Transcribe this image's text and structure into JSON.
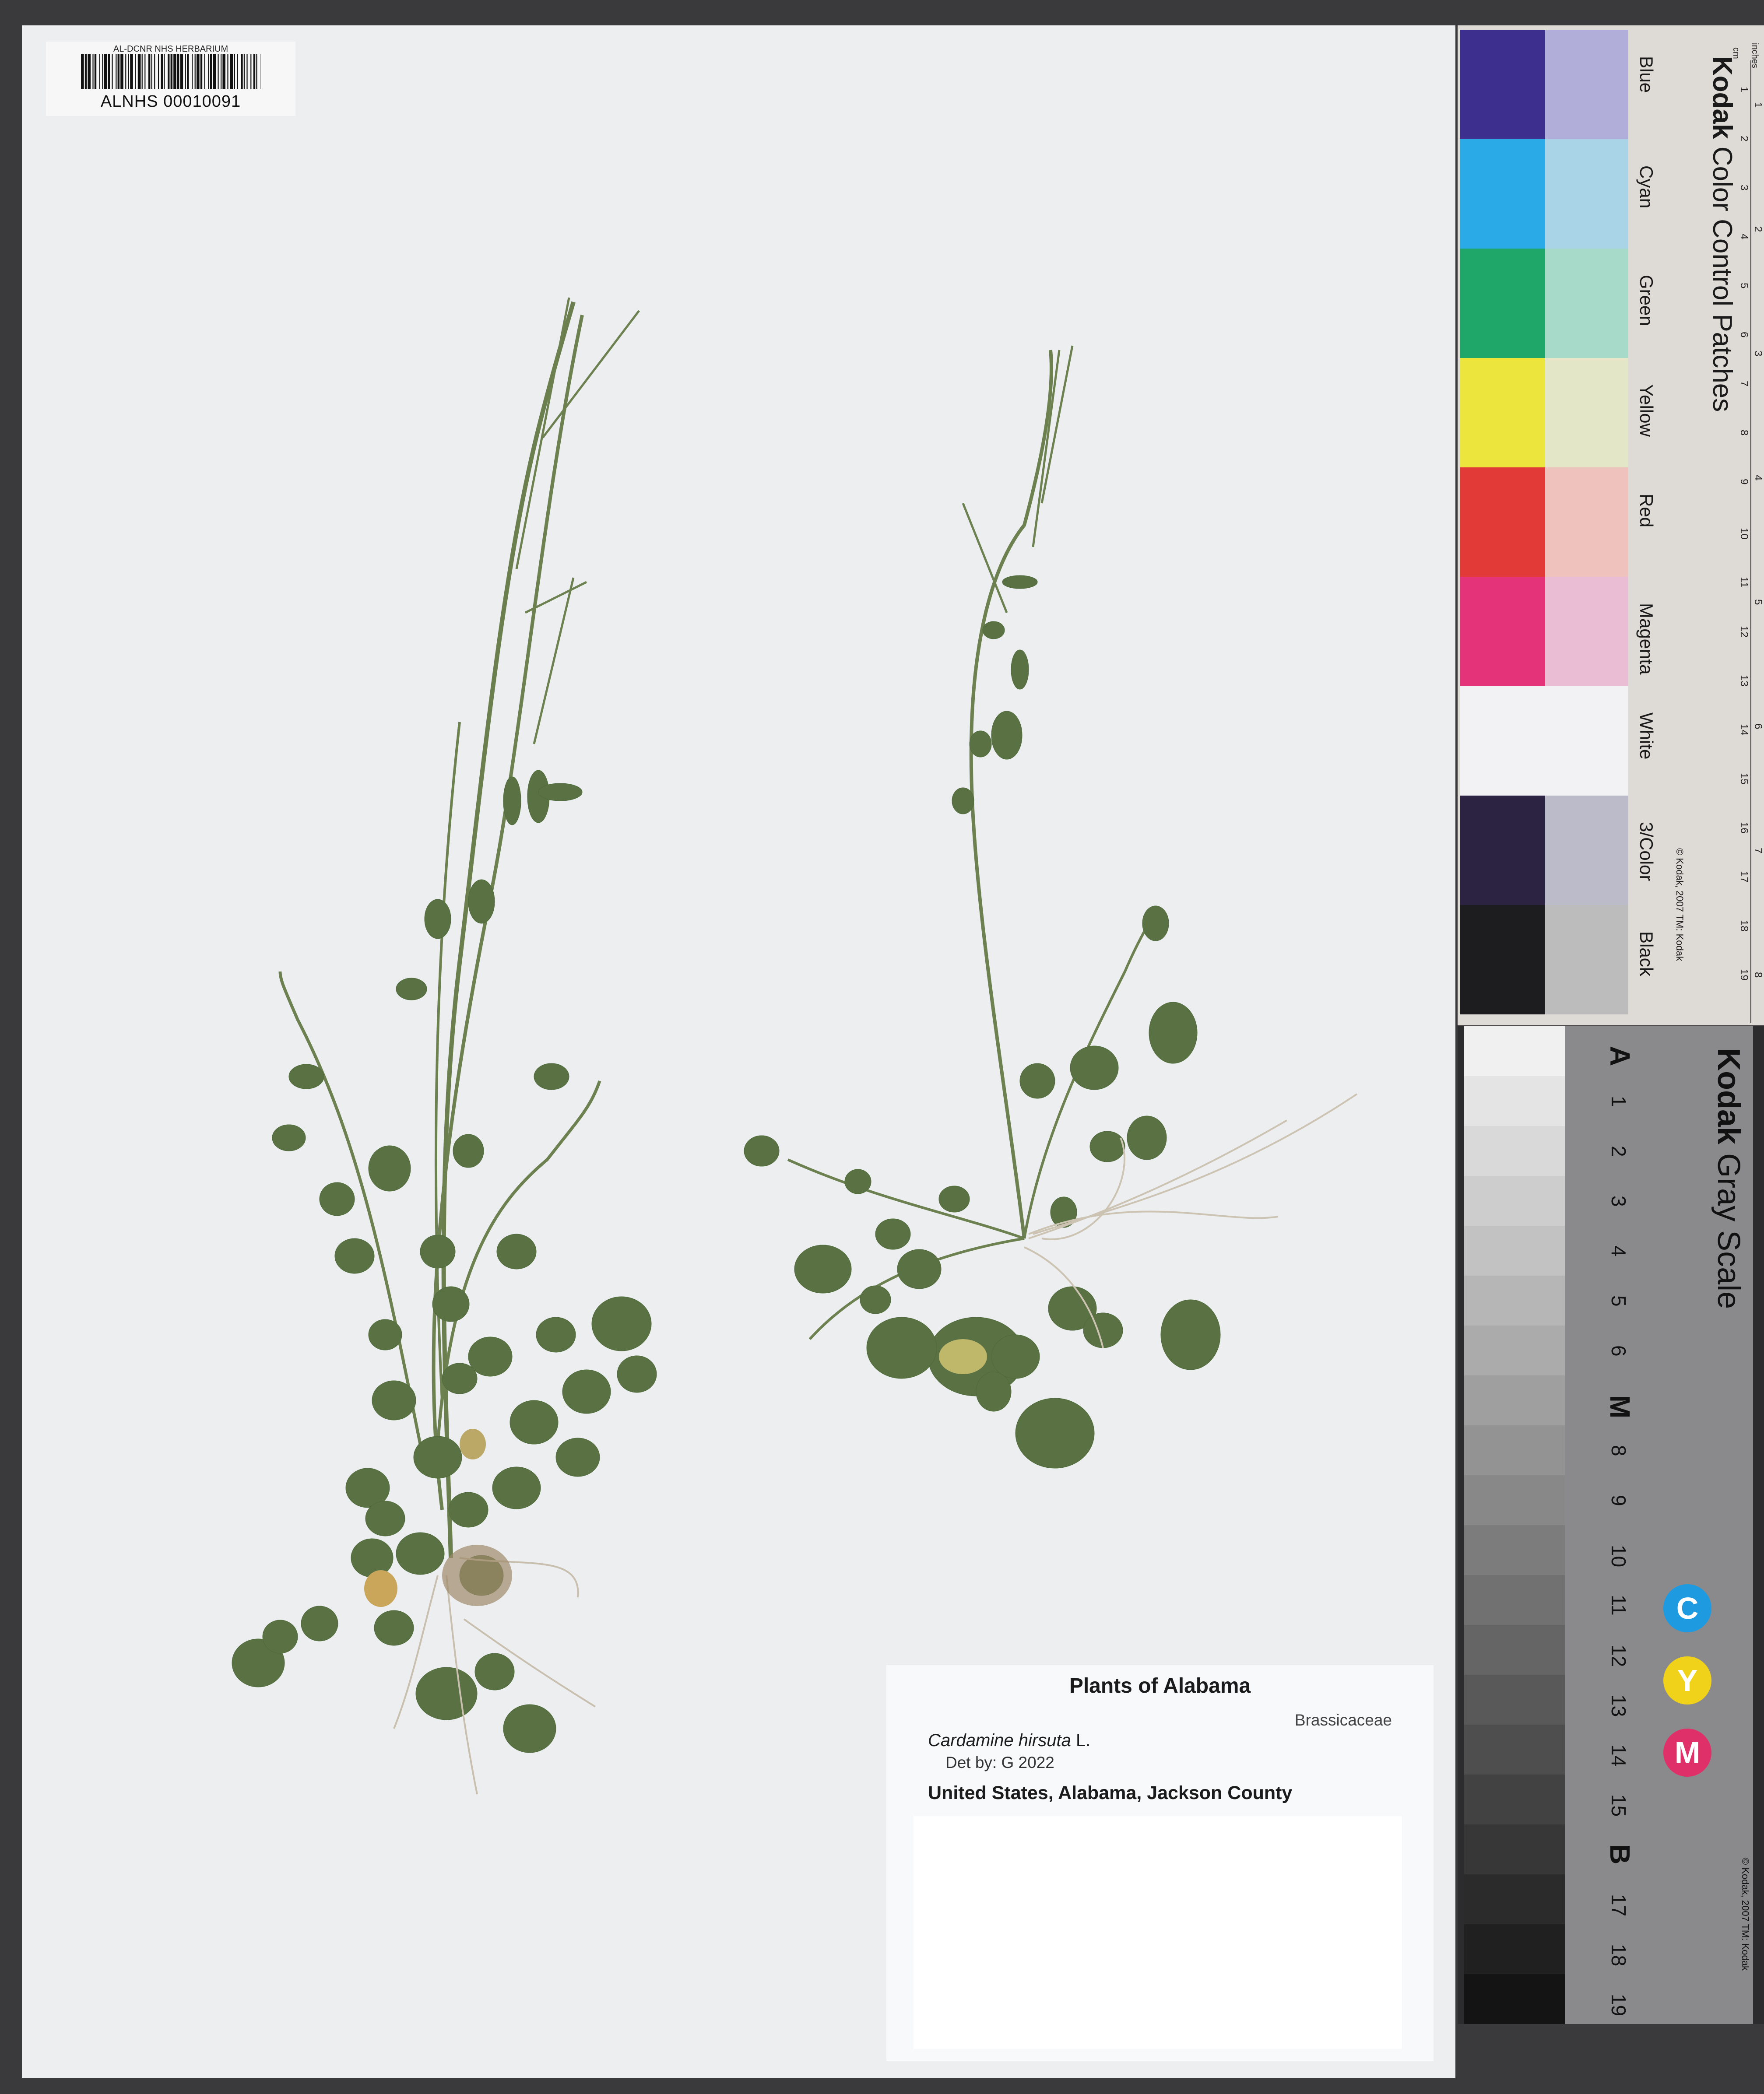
{
  "barcode": {
    "institution": "AL-DCNR NHS HERBARIUM",
    "catalog_number": "ALNHS 00010091"
  },
  "label": {
    "title": "Plants of Alabama",
    "family": "Brassicaceae",
    "genus_species": "Cardamine hirsuta",
    "author": "L.",
    "determination": "Det by: G 2022",
    "locality": "United States, Alabama, Jackson County"
  },
  "color_card": {
    "brand": "Kodak",
    "title": "Color Control Patches",
    "copyright": "© Kodak, 2007 TM: Kodak",
    "ruler_cm_label": "cm",
    "ruler_inch_label": "inches",
    "cm_ticks": [
      "1",
      "2",
      "3",
      "4",
      "5",
      "6",
      "7",
      "8",
      "9",
      "10",
      "11",
      "12",
      "13",
      "14",
      "15",
      "16",
      "17",
      "18",
      "19"
    ],
    "inch_ticks": [
      "1",
      "2",
      "3",
      "4",
      "5",
      "6",
      "7",
      "8"
    ],
    "patches": [
      {
        "name": "Blue",
        "dark": "#3c2f8e",
        "light": "#b1aed9"
      },
      {
        "name": "Cyan",
        "dark": "#2aaae6",
        "light": "#a9d4e7"
      },
      {
        "name": "Green",
        "dark": "#1fa76a",
        "light": "#a7dac9"
      },
      {
        "name": "Yellow",
        "dark": "#ece53e",
        "light": "#e3e7c8"
      },
      {
        "name": "Red",
        "dark": "#e23a36",
        "light": "#efc2bd"
      },
      {
        "name": "Magenta",
        "dark": "#e53379",
        "light": "#ebbdd4"
      },
      {
        "name": "White",
        "dark": "#f2f2f4",
        "light": "#f2f2f4"
      },
      {
        "name": "3/Color",
        "dark": "#2c2241",
        "light": "#bcbbca"
      },
      {
        "name": "Black",
        "dark": "#1d1d1f",
        "light": "#bcbcbc"
      }
    ]
  },
  "gray_card": {
    "brand": "Kodak",
    "title": "Gray Scale",
    "copyright": "© Kodak, 2007 TM: Kodak",
    "steps": [
      "A",
      "1",
      "2",
      "3",
      "4",
      "5",
      "6",
      "M",
      "8",
      "9",
      "10",
      "11",
      "12",
      "13",
      "14",
      "15",
      "B",
      "17",
      "18",
      "19"
    ],
    "circles": [
      {
        "letter": "C",
        "color": "#1e9be0"
      },
      {
        "letter": "Y",
        "color": "#f0d21a"
      },
      {
        "letter": "M",
        "color": "#e0306a"
      }
    ]
  }
}
